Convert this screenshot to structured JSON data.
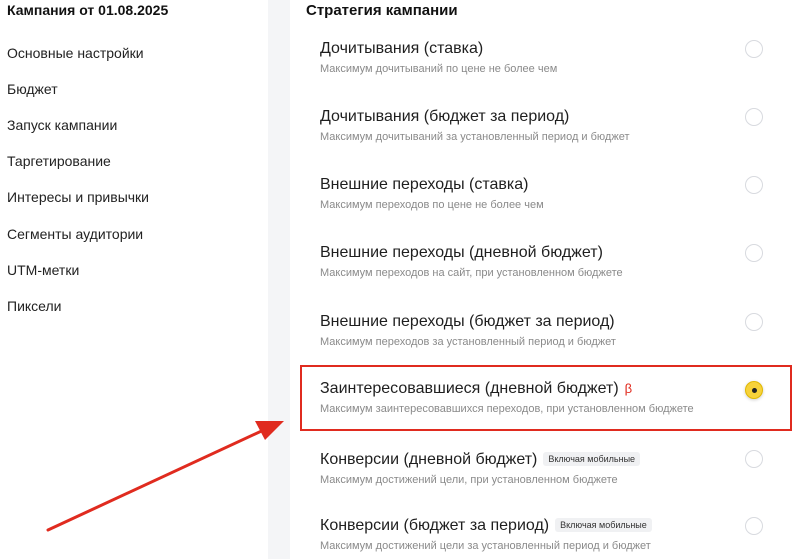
{
  "sidebar": {
    "campaign_title": "Кампания от 01.08.2025",
    "items": [
      {
        "label": "Основные настройки"
      },
      {
        "label": "Бюджет"
      },
      {
        "label": "Запуск кампании"
      },
      {
        "label": "Таргетирование"
      },
      {
        "label": "Интересы и привычки"
      },
      {
        "label": "Сегменты аудитории"
      },
      {
        "label": "UTM-метки"
      },
      {
        "label": "Пиксели"
      }
    ]
  },
  "main": {
    "section_title": "Стратегия кампании",
    "options": [
      {
        "title": "Дочитывания (ставка)",
        "subtitle": "Максимум дочитываний по цене не более чем",
        "selected": false
      },
      {
        "title": "Дочитывания (бюджет за период)",
        "subtitle": "Максимум дочитываний за установленный период и бюджет",
        "selected": false
      },
      {
        "title": "Внешние переходы (ставка)",
        "subtitle": "Максимум переходов по цене не более чем",
        "selected": false
      },
      {
        "title": "Внешние переходы (дневной бюджет)",
        "subtitle": "Максимум переходов на сайт, при установленном бюджете",
        "selected": false
      },
      {
        "title": "Внешние переходы (бюджет за период)",
        "subtitle": "Максимум переходов за установленный период и бюджет",
        "selected": false
      },
      {
        "title": "Заинтересовавшиеся (дневной бюджет)",
        "beta": "β",
        "subtitle": "Максимум заинтересовавшихся переходов, при установленном бюджете",
        "selected": true
      },
      {
        "title": "Конверсии (дневной бюджет)",
        "badge": "Включая мобильные",
        "subtitle": "Максимум достижений цели, при установленном бюджете",
        "selected": false
      },
      {
        "title": "Конверсии (бюджет за период)",
        "badge": "Включая мобильные",
        "subtitle": "Максимум достижений цели за установленный период и бюджет",
        "selected": false
      }
    ]
  },
  "colors": {
    "accent": "#f7d23a",
    "highlight": "#e02b1f",
    "beta": "#e0261a"
  }
}
